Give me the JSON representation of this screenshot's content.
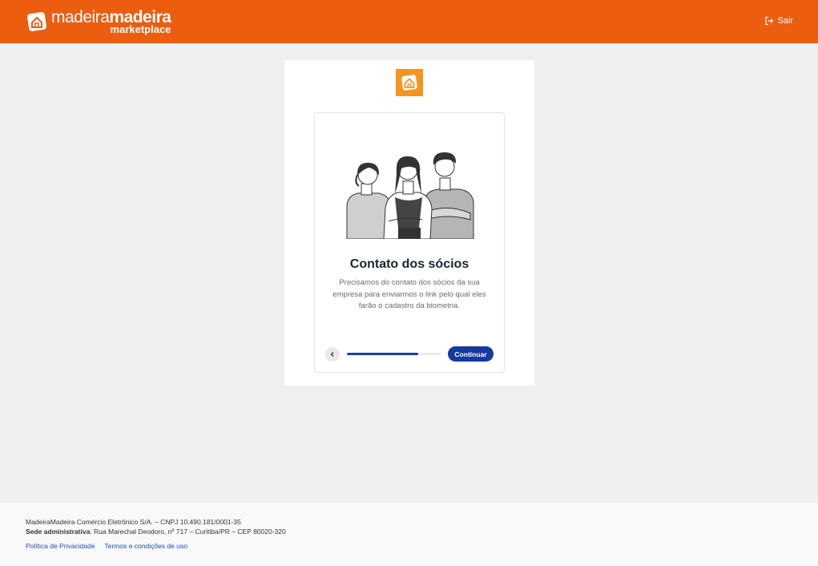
{
  "header": {
    "brand_regular": "madeira",
    "brand_bold": "madeira",
    "brand_sub": "marketplace",
    "logout_label": "Sair"
  },
  "step": {
    "title": "Contato dos sócios",
    "description": "Precisamos do contato dos sócios da sua empresa para enviarmos o link pelo qual eles farão o cadastro da biometria.",
    "continue_label": "Continuar",
    "progress_fraction": 0.75
  },
  "footer": {
    "company_line": "MadeiraMadeira Comércio Eletrônico S/A. – CNPJ 10.490.181/0001-35",
    "hq_label": "Sede administrativa",
    "hq_address": "Rua Marechal Deodoro, nº 717 – Curitiba/PR – CEP 80020-320",
    "privacy_link": "Política de Privacidade",
    "terms_link": "Termos e condições de uso"
  },
  "colors": {
    "brand_orange": "#ec5d10",
    "accent_blue": "#153a9e",
    "card_logo_orange": "#f7941d"
  },
  "icons": {
    "logout": "logout-icon",
    "back": "chevron-left-icon"
  }
}
